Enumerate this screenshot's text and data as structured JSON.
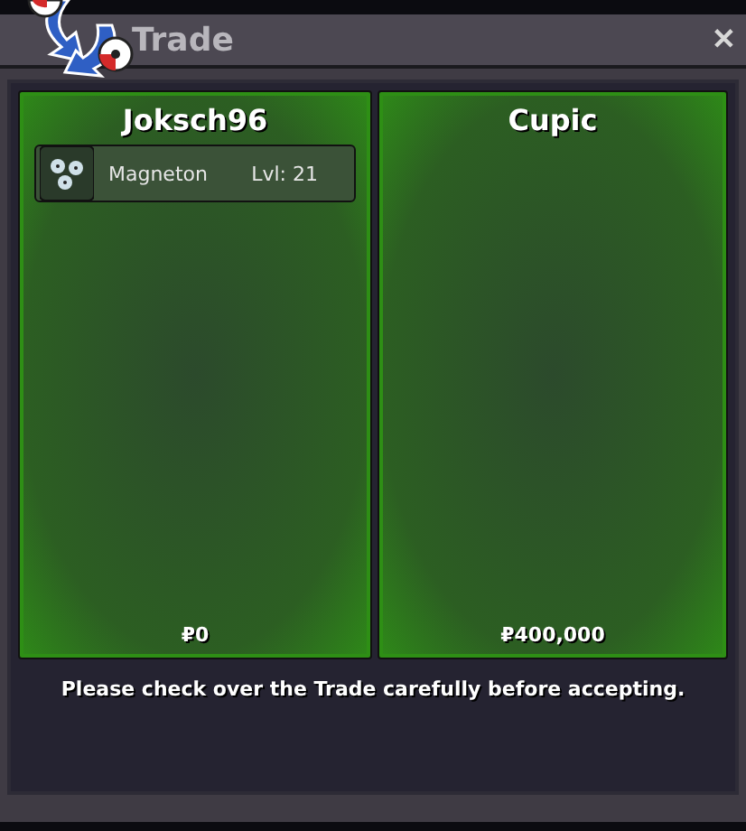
{
  "window": {
    "title": "Trade",
    "close": "✕"
  },
  "panels": [
    {
      "name": "Joksch96",
      "items": [
        {
          "name": "Magneton",
          "level": "Lvl: 21"
        }
      ],
      "money": "₽0"
    },
    {
      "name": "Cupic",
      "money": "₽400,000"
    }
  ],
  "message": "Please check over the Trade carefully before accepting."
}
